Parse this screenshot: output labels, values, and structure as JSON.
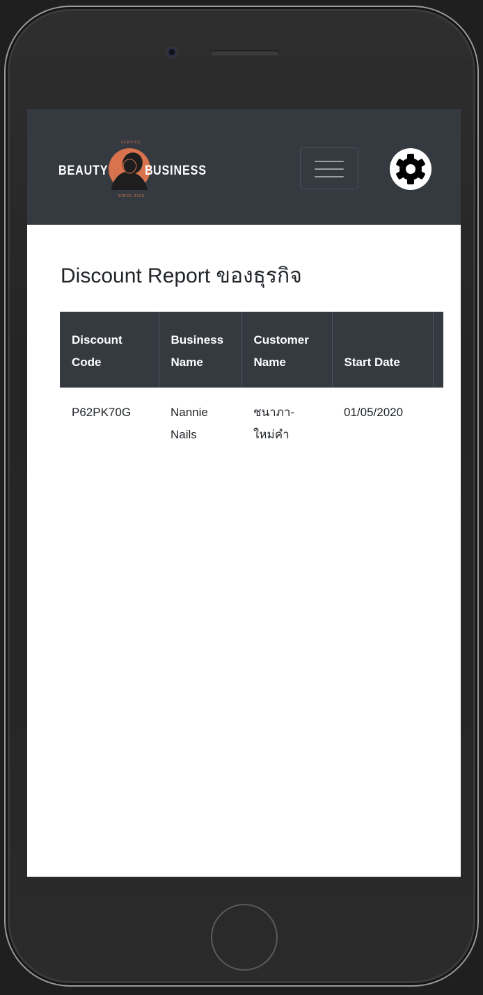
{
  "brand": {
    "name_left": "BEAUTY",
    "name_right": "USINESS",
    "name_initial": "B",
    "tagline_top": "SERVICE",
    "tagline_bottom": "SINCE 2020",
    "accent_color": "#d9734e"
  },
  "navbar": {
    "menu_icon": "hamburger-icon",
    "settings_icon": "gear-icon",
    "background": "#343a40"
  },
  "page": {
    "title": "Discount Report ของธุรกิจ"
  },
  "table": {
    "headers": [
      {
        "line1": "Discount",
        "line2": "Code"
      },
      {
        "line1": "Business",
        "line2": "Name"
      },
      {
        "line1": "Customer",
        "line2": "Name"
      },
      {
        "line1": "",
        "line2": "Start Date"
      },
      {
        "line1": "",
        "line2": ""
      }
    ],
    "rows": [
      {
        "discount_code": "P62PK70G",
        "business_name_1": "Nannie",
        "business_name_2": "Nails",
        "customer_name_1": "ชนาภา-",
        "customer_name_2": "ใหม่คำ",
        "start_date": "01/05/2020"
      }
    ]
  }
}
